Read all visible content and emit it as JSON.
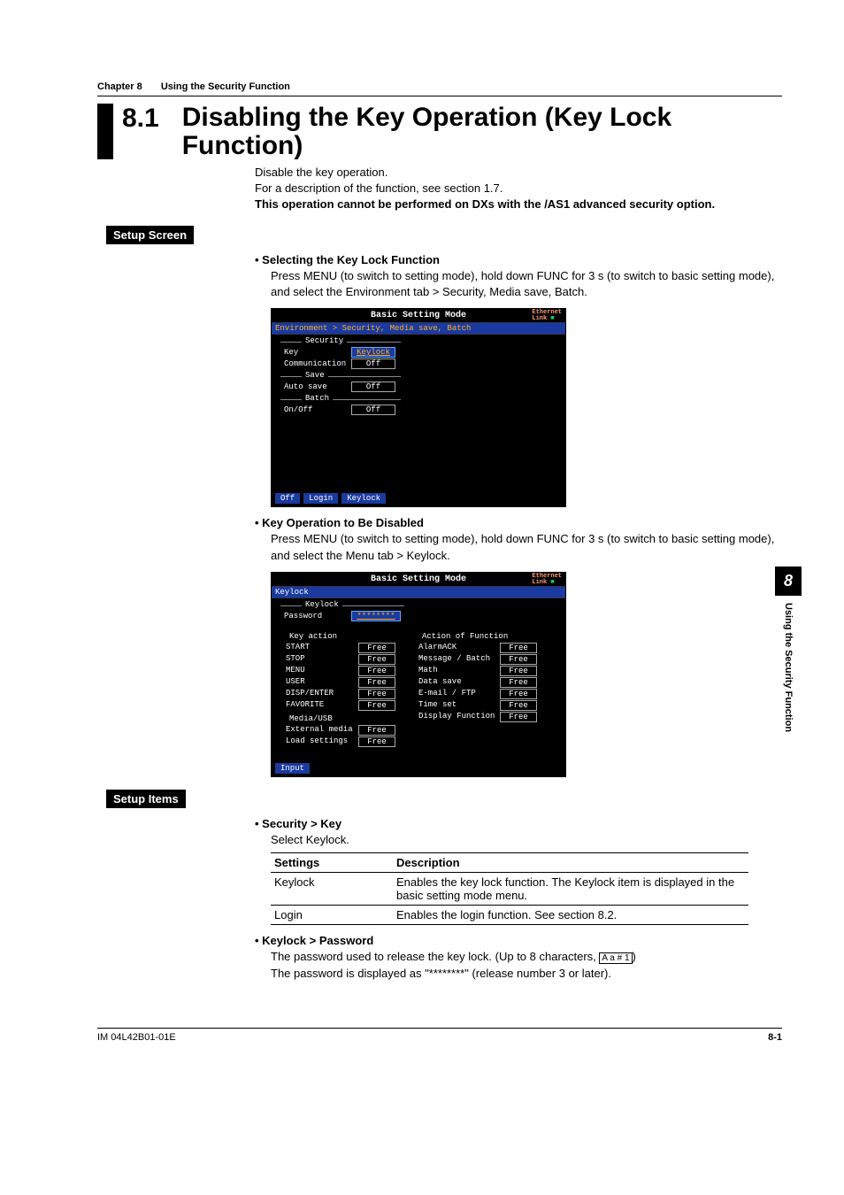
{
  "running_head": {
    "chapter": "Chapter 8",
    "title": "Using the Security Function"
  },
  "section": {
    "number": "8.1",
    "title": "Disabling the Key Operation (Key Lock Function)"
  },
  "intro": {
    "line1": "Disable the key operation.",
    "line2": "For a description of the function, see section 1.7.",
    "line3": "This operation cannot be performed on DXs with the /AS1 advanced security option."
  },
  "headings": {
    "setup_screen": "Setup Screen",
    "setup_items": "Setup Items"
  },
  "bullets": {
    "select_keylock": {
      "head": "Selecting the Key Lock Function",
      "body_pre": "Press ",
      "menu": "MENU",
      "body_mid1": " (to switch to setting mode), hold down ",
      "func": "FUNC",
      "body_mid2": " for 3 s (to switch to basic setting mode), and select the ",
      "env": "Environment",
      "body_mid3": " tab > ",
      "tail": "Security, Media save, Batch",
      "period": "."
    },
    "keyop_disable": {
      "head": "Key Operation to Be Disabled",
      "body_pre": "Press ",
      "menu": "MENU",
      "body_mid1": " (to switch to setting mode), hold down ",
      "func": "FUNC",
      "body_mid2": " for 3 s (to switch to basic setting mode), and select the ",
      "menu_tab": "Menu",
      "body_mid3": " tab > ",
      "tail": "Keylock",
      "period": "."
    },
    "security_key": {
      "head": "Security > Key",
      "body_pre": "Select ",
      "keylock": "Keylock",
      "period": "."
    },
    "keylock_password": {
      "head": "Keylock > Password",
      "line1_pre": "The password used to release the key lock. (Up to 8 characters, ",
      "glyph": "A a # 1",
      "line1_post": ")",
      "line2": "The password is displayed as \"********\" (release number 3 or later)."
    }
  },
  "screenshot1": {
    "title": "Basic Setting Mode",
    "eth1": "Ethernet",
    "eth2": "Link",
    "crumb": "Environment > Security, Media save, Batch",
    "groups": {
      "security": {
        "label": "Security",
        "rows": [
          {
            "k": "Key",
            "v": "Keylock",
            "sel": true
          },
          {
            "k": "Communication",
            "v": "Off"
          }
        ]
      },
      "save": {
        "label": "Save",
        "rows": [
          {
            "k": "Auto save",
            "v": "Off"
          }
        ]
      },
      "batch": {
        "label": "Batch",
        "rows": [
          {
            "k": "On/Off",
            "v": "Off"
          }
        ]
      }
    },
    "softkeys": [
      "Off",
      "Login",
      "Keylock"
    ]
  },
  "screenshot2": {
    "title": "Basic Setting Mode",
    "eth1": "Ethernet",
    "eth2": "Link",
    "crumb": "Keylock",
    "group_label": "Keylock",
    "password_row": {
      "k": "Password",
      "v": "********",
      "sel": true
    },
    "left": {
      "head": "Key action",
      "rows": [
        {
          "k": "START",
          "v": "Free"
        },
        {
          "k": "STOP",
          "v": "Free"
        },
        {
          "k": "MENU",
          "v": "Free"
        },
        {
          "k": "USER",
          "v": "Free"
        },
        {
          "k": "DISP/ENTER",
          "v": "Free"
        },
        {
          "k": "FAVORITE",
          "v": "Free"
        }
      ],
      "head2": "Media/USB",
      "rows2": [
        {
          "k": "External media",
          "v": "Free"
        },
        {
          "k": "Load settings",
          "v": "Free"
        }
      ]
    },
    "right": {
      "head": "Action of Function",
      "rows": [
        {
          "k": "AlarmACK",
          "v": "Free"
        },
        {
          "k": "Message / Batch",
          "v": "Free"
        },
        {
          "k": "Math",
          "v": "Free"
        },
        {
          "k": "Data save",
          "v": "Free"
        },
        {
          "k": "E-mail / FTP",
          "v": "Free"
        },
        {
          "k": "Time set",
          "v": "Free"
        },
        {
          "k": "Display Function",
          "v": "Free"
        }
      ]
    },
    "softkeys": [
      "Input"
    ]
  },
  "settings_table": {
    "head": {
      "c1": "Settings",
      "c2": "Description"
    },
    "rows": [
      {
        "c1": "Keylock",
        "c2_pre": "Enables the key lock function. The ",
        "c2_bold": "Keylock",
        "c2_post": " item is displayed in the basic setting mode menu."
      },
      {
        "c1": "Login",
        "c2": "Enables the login function. See section 8.2."
      }
    ]
  },
  "side_tab": {
    "num": "8",
    "text": "Using the Security Function"
  },
  "footer": {
    "left": "IM 04L42B01-01E",
    "right": "8-1"
  }
}
